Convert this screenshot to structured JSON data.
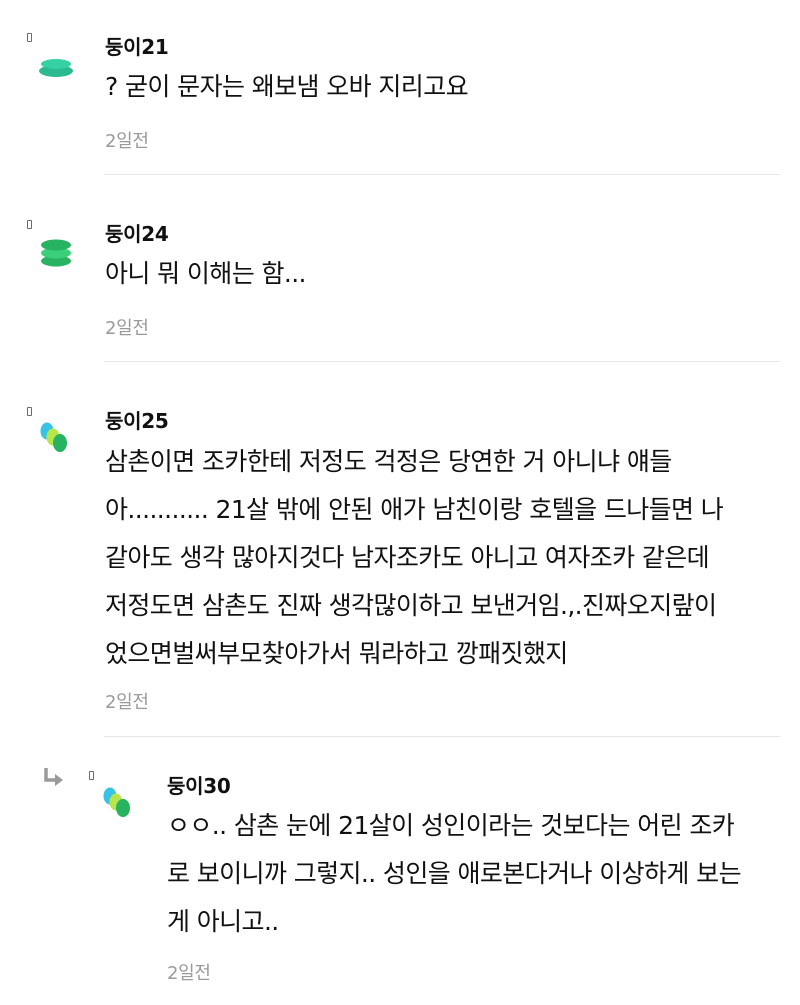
{
  "comments": [
    {
      "author": "둥이21",
      "lines": [
        "? 굳이 문자는 왜보냄 오바 지리고요"
      ],
      "time": "2일전",
      "avatar_icon": "flat-stack-avatar-icon",
      "avatar_colors": [
        "#2bb98f",
        "#35d0a4"
      ]
    },
    {
      "author": "둥이24",
      "lines": [
        "아니 뭐 이해는 함..."
      ],
      "time": "2일전",
      "avatar_icon": "stacked-discs-avatar-icon",
      "avatar_colors": [
        "#27b35f",
        "#3ccf7a"
      ]
    },
    {
      "author": "둥이25",
      "lines": [
        "삼촌이면 조카한테 저정도 걱정은 당연한 거 아니냐 얘들",
        "아........... 21살 밖에 안된 애가 남친이랑 호텔을 드나들면 나",
        "같아도 생각 많아지것다 남자조카도 아니고 여자조카 같은데",
        "저정도면 삼촌도 진짜 생각많이하고 보낸거임.,.진짜오지랖이",
        "었으면벌써부모찾아가서 뭐라하고 깡패짓했지"
      ],
      "time": "2일전",
      "avatar_icon": "overlapping-dots-avatar-icon",
      "avatar_colors": [
        "#37c3e6",
        "#b7e54a",
        "#27b35f"
      ]
    }
  ],
  "reply": {
    "author": "둥이30",
    "lines": [
      "ㅇㅇ.. 삼촌 눈에 21살이 성인이라는 것보다는 어린 조카",
      "로 보이니까 그렇지.. 성인을 애로본다거나 이상하게 보는",
      "게 아니고.."
    ],
    "time": "2일전",
    "reply_icon": "reply-arrow-icon",
    "avatar_icon": "overlapping-dots-avatar-icon",
    "avatar_colors": [
      "#37c3e6",
      "#b7e54a",
      "#27b35f"
    ]
  }
}
